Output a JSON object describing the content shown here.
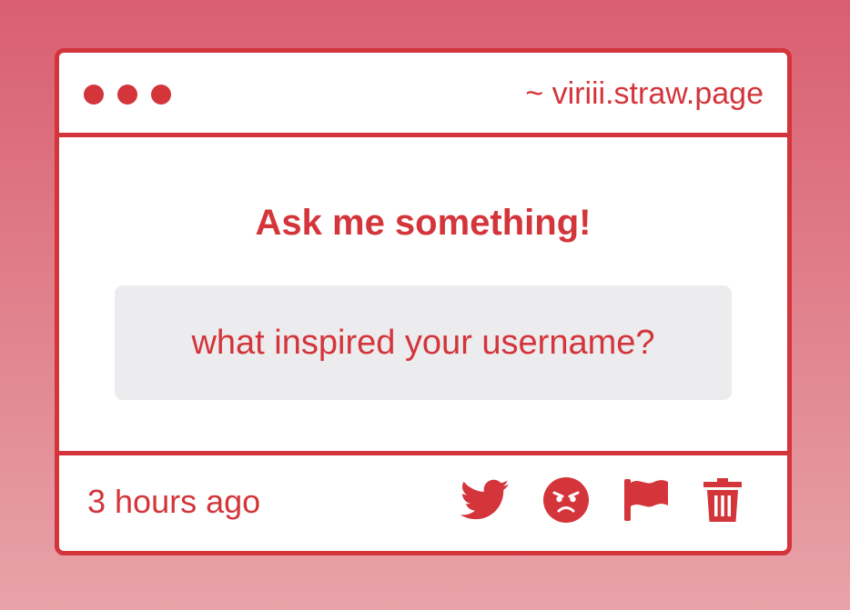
{
  "window": {
    "url": "~ viriii.straw.page",
    "controls": [
      "dot-1",
      "dot-2",
      "dot-3"
    ]
  },
  "main": {
    "heading": "Ask me something!",
    "question": "what inspired your username?"
  },
  "footer": {
    "timestamp": "3 hours ago",
    "actions": [
      {
        "icon": "twitter-icon"
      },
      {
        "icon": "angry-face-icon"
      },
      {
        "icon": "flag-icon"
      },
      {
        "icon": "trash-icon"
      }
    ]
  },
  "colors": {
    "accent": "#d3353b",
    "question_bg": "#ecebed",
    "card_bg": "#ffffff",
    "page_bg_top": "#d95f70",
    "page_bg_bottom": "#e8a3a9"
  }
}
